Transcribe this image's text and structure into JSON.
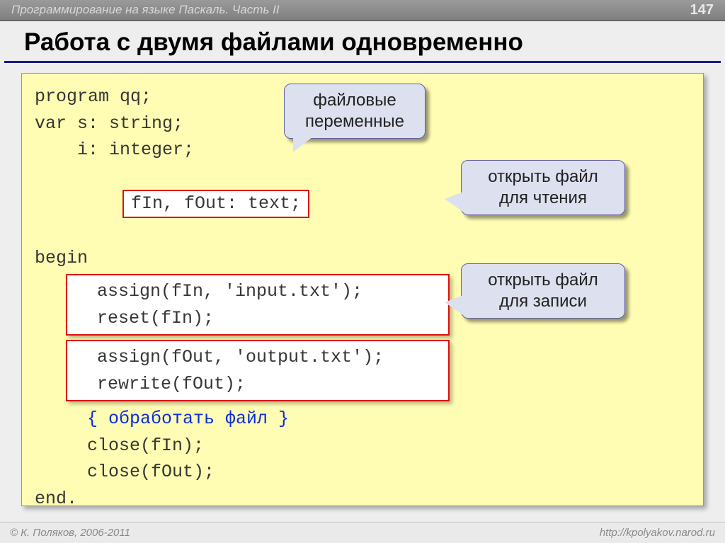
{
  "header": {
    "course_title": "Программирование на языке Паскаль. Часть II",
    "page_number": "147"
  },
  "title": "Работа с двумя файлами одновременно",
  "code": {
    "l1": "program qq;",
    "l2": "var s: string;",
    "l3": "    i: integer;",
    "l4": "fIn, fOut: text;",
    "l5": "begin",
    "l6": "  assign(fIn, 'input.txt');",
    "l7": "  reset(fIn);",
    "l8": "  assign(fOut, 'output.txt');",
    "l9": "  rewrite(fOut);",
    "l10": "  { обработать файл }",
    "l11": "  close(fIn);",
    "l12": "  close(fOut);",
    "l13": "end."
  },
  "callouts": {
    "c1": "файловые переменные",
    "c2": "открыть файл для чтения",
    "c3": "открыть файл для записи"
  },
  "footer": {
    "copyright": "© К. Поляков, 2006-2011",
    "url": "http://kpolyakov.narod.ru"
  }
}
